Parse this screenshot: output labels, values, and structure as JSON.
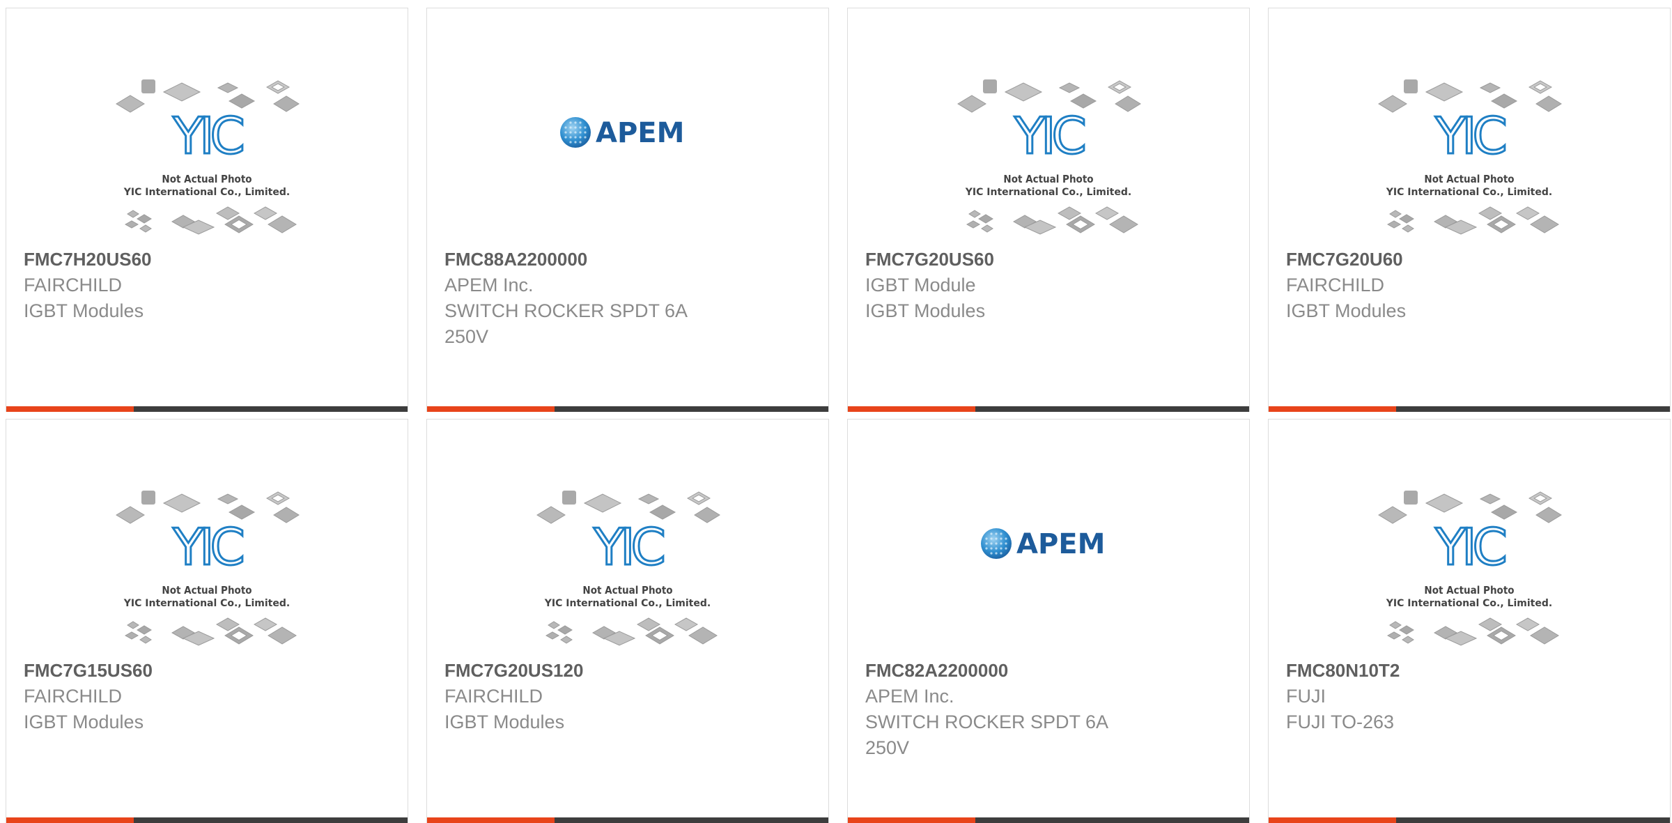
{
  "colors": {
    "accent": "#e8441a",
    "bar": "#3d3d3d",
    "part_text": "#5f5f5f",
    "meta_text": "#8a8a8a",
    "yic_blue": "#1f7fc4",
    "apem_blue": "#1d5b9b"
  },
  "placeholder_image": {
    "line1": "Not Actual Photo",
    "line2": "YIC International Co., Limited.",
    "logo_text": "YIC"
  },
  "apem_logo": {
    "text": "APEM"
  },
  "products": [
    {
      "part": "FMC7H20US60",
      "manufacturer": "FAIRCHILD",
      "description": "IGBT Modules",
      "image": "yic-placeholder"
    },
    {
      "part": "FMC88A2200000",
      "manufacturer": "APEM Inc.",
      "description": "SWITCH ROCKER SPDT 6A 250V",
      "image": "apem-logo"
    },
    {
      "part": "FMC7G20US60",
      "manufacturer": "IGBT Module",
      "description": "IGBT Modules",
      "image": "yic-placeholder"
    },
    {
      "part": "FMC7G20U60",
      "manufacturer": "FAIRCHILD",
      "description": "IGBT Modules",
      "image": "yic-placeholder"
    },
    {
      "part": "FMC7G15US60",
      "manufacturer": "FAIRCHILD",
      "description": "IGBT Modules",
      "image": "yic-placeholder"
    },
    {
      "part": "FMC7G20US120",
      "manufacturer": "FAIRCHILD",
      "description": "IGBT Modules",
      "image": "yic-placeholder"
    },
    {
      "part": "FMC82A2200000",
      "manufacturer": "APEM Inc.",
      "description": "SWITCH ROCKER SPDT 6A 250V",
      "image": "apem-logo"
    },
    {
      "part": "FMC80N10T2",
      "manufacturer": "FUJI",
      "description": "FUJI TO-263",
      "image": "yic-placeholder"
    }
  ]
}
